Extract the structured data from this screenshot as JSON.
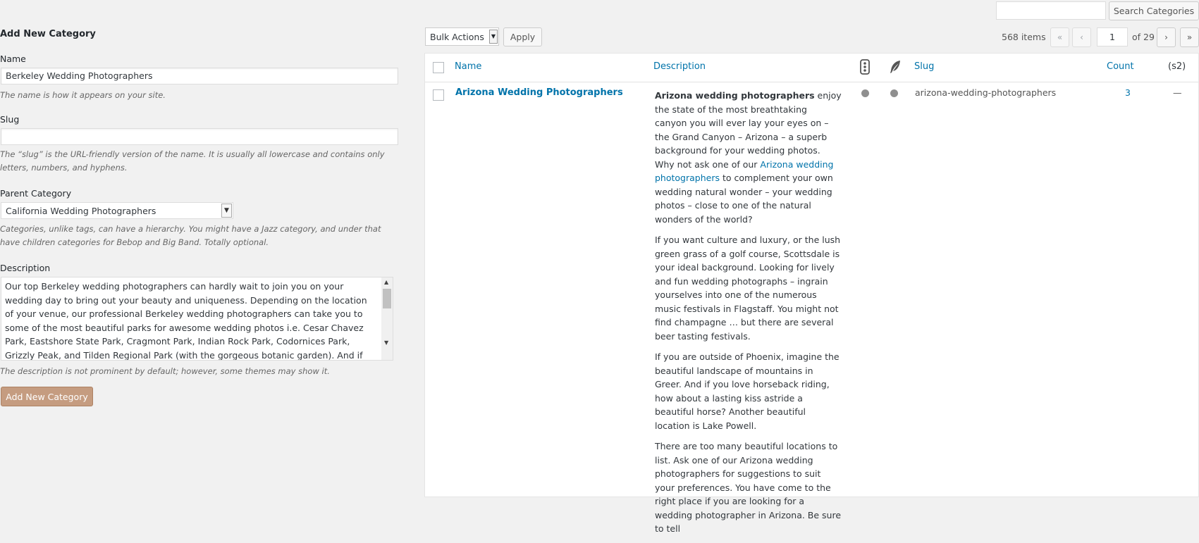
{
  "form": {
    "title": "Add New Category",
    "name_label": "Name",
    "name_value": "Berkeley Wedding Photographers",
    "name_help": "The name is how it appears on your site.",
    "slug_label": "Slug",
    "slug_value": "",
    "slug_help": "The “slug” is the URL-friendly version of the name. It is usually all lowercase and contains only letters, numbers, and hyphens.",
    "parent_label": "Parent Category",
    "parent_value": "California Wedding Photographers",
    "parent_help": "Categories, unlike tags, can have a hierarchy. You might have a Jazz category, and under that have children categories for Bebop and Big Band. Totally optional.",
    "description_label": "Description",
    "description_value": "Our top Berkeley wedding photographers can hardly wait to join you on your wedding day to bring out your beauty and uniqueness. Depending on the location of your venue, our professional Berkeley wedding photographers can take you to some of the most beautiful parks for awesome wedding photos i.e. Cesar Chavez Park, Eastshore State Park, Cragmont Park, Indian Rock Park, Codornices Park, Grizzly Peak, and Tilden Regional Park (with the gorgeous botanic garden). And if you love the",
    "description_help": "The description is not prominent by default; however, some themes may show it.",
    "submit_label": "Add New Category"
  },
  "search": {
    "value": "",
    "button_label": "Search Categories"
  },
  "toolbar": {
    "bulk_actions": "Bulk Actions",
    "apply_label": "Apply",
    "items_count": "568 items",
    "first_page": "«",
    "prev_page": "‹",
    "current_page": "1",
    "total_pages": "of 29",
    "next_page": "›",
    "last_page": "»"
  },
  "table": {
    "columns": {
      "name": "Name",
      "description": "Description",
      "slug": "Slug",
      "count": "Count",
      "s2": "(s2)"
    },
    "icons": [
      "traffic-light-icon",
      "feather-icon"
    ],
    "row": {
      "name": "Arizona Wedding Photographers",
      "desc_p1_bold": "Arizona wedding photographers",
      "desc_p1_a": " enjoy the state of the most breathtaking canyon you will ever lay your eyes on – the Grand Canyon – Arizona – a superb background for your wedding photos. Why not ask one of our ",
      "desc_p1_link": "Arizona wedding photographers",
      "desc_p1_b": " to complement your own wedding natural wonder – your wedding photos – close to one of the natural wonders of the world?",
      "desc_p2": "If you want culture and luxury, or the lush green grass of a golf course, Scottsdale is your ideal background. Looking for lively and fun wedding photographs – ingrain yourselves into one of the numerous music festivals in Flagstaff. You might not find champagne … but there are several beer tasting festivals.",
      "desc_p3": "If you are outside of Phoenix, imagine the beautiful landscape of mountains in Greer. And if you love horseback riding, how about a lasting kiss astride a beautiful horse? Another beautiful location is Lake Powell.",
      "desc_p4": "There are too many beautiful locations to list. Ask one of our Arizona wedding photographers for suggestions to suit your preferences. You have come to the right place if you are looking for a wedding photographer in Arizona. Be sure to tell",
      "slug": "arizona-wedding-photographers",
      "count": "3",
      "s2": "—"
    }
  },
  "colors": {
    "link": "#0073aa",
    "submit_button": "#c59c80",
    "background": "#f1f1f1"
  }
}
